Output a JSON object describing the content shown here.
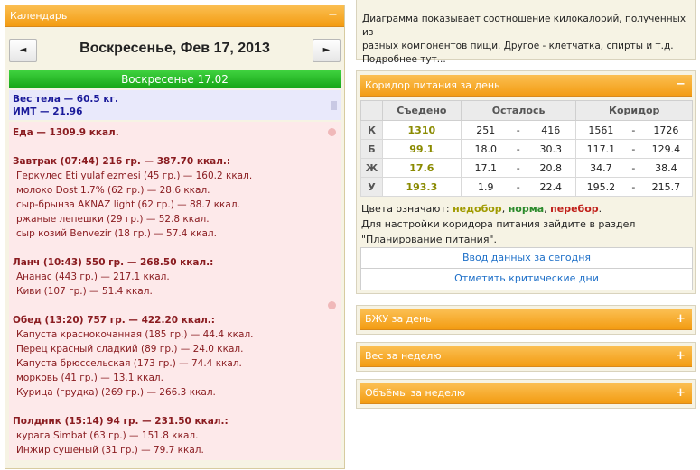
{
  "calendar": {
    "title": "Календарь",
    "collapse_icon": "minus-icon",
    "date_title": "Воскресенье, Фев 17, 2013",
    "prev_label": "◄",
    "next_label": "►",
    "day_bar": "Воскресенье 17.02",
    "weight_line": "Вес тела — 60.5 кг.",
    "bmi_line": "ИМТ — 21.96",
    "food_total": "Еда — 1309.9 ккал.",
    "meals": [
      {
        "header": "Завтрак (07:44) 216 гр. — 387.70 ккал.:",
        "items": [
          "Геркулес Eti yulaf ezmesi (45 гр.) — 160.2 ккал.",
          "молоко Dost 1.7% (62 гр.) — 28.6 ккал.",
          "сыр-брынза AKNAZ light (62 гр.) — 88.7 ккал.",
          "ржаные лепешки (29 гр.) — 52.8 ккал.",
          "сыр козий Benvezir (18 гр.) — 57.4 ккал."
        ]
      },
      {
        "header": "Ланч (10:43) 550 гр. — 268.50 ккал.:",
        "items": [
          "Ананас (443 гр.) — 217.1 ккал.",
          "Киви (107 гр.) — 51.4 ккал."
        ]
      },
      {
        "header": "Обед (13:20) 757 гр. — 422.20 ккал.:",
        "items": [
          "Капуста краснокочанная (185 гр.) — 44.4 ккал.",
          "Перец красный сладкий (89 гр.) — 24.0 ккал.",
          "Капуста брюссельская (173 гр.) — 74.4 ккал.",
          "морковь (41 гр.) — 13.1 ккал.",
          "Курица (грудка) (269 гр.) — 266.3 ккал."
        ]
      },
      {
        "header": "Полдник (15:14) 94 гр. — 231.50 ккал.:",
        "items": [
          "курага Simbat (63 гр.) — 151.8 ккал.",
          "Инжир сушеный (31 гр.) — 79.7 ккал."
        ]
      }
    ]
  },
  "diagram": {
    "line1": "Диаграмма показывает соотношение килокалорий, полученных из",
    "line2": "разных компонентов пищи. Другое - клетчатка, спирты и т.д.",
    "more_link": "Подробнее тут..."
  },
  "corridor": {
    "title": "Коридор питания за день",
    "collapse_icon": "minus-icon",
    "headers": [
      "",
      "Съедено",
      "Осталось",
      "Коридор"
    ],
    "rows": [
      {
        "letter": "К",
        "eaten": "1310",
        "left_from": "251",
        "left_to": "416",
        "corr_from": "1561",
        "corr_to": "1726"
      },
      {
        "letter": "Б",
        "eaten": "99.1",
        "left_from": "18.0",
        "left_to": "30.3",
        "corr_from": "117.1",
        "corr_to": "129.4"
      },
      {
        "letter": "Ж",
        "eaten": "17.6",
        "left_from": "17.1",
        "left_to": "20.8",
        "corr_from": "34.7",
        "corr_to": "38.4"
      },
      {
        "letter": "У",
        "eaten": "193.3",
        "left_from": "1.9",
        "left_to": "22.4",
        "corr_from": "195.2",
        "corr_to": "215.7"
      }
    ],
    "dash": "-",
    "legend_prefix": "Цвета означают: ",
    "legend_under": "недобор",
    "legend_sep1": ", ",
    "legend_norm": "норма",
    "legend_sep2": ", ",
    "legend_over": "перебор",
    "legend_end": ".",
    "settings_line1": "Для настройки коридора питания зайдите в раздел",
    "settings_line2": "\"Планирование питания\".",
    "btn_enter": "Ввод данных за сегодня",
    "btn_critical": "Отметить критические дни"
  },
  "panels": {
    "bju": "БЖУ за день",
    "weight_week": "Вес за неделю",
    "volume_week": "Объёмы за неделю",
    "expand_icon": "plus-icon"
  },
  "colors": {
    "header_orange": "#f39c12",
    "day_green": "#16a516",
    "link_blue": "#1d6fc8",
    "eaten_olive": "#8a8a00"
  }
}
